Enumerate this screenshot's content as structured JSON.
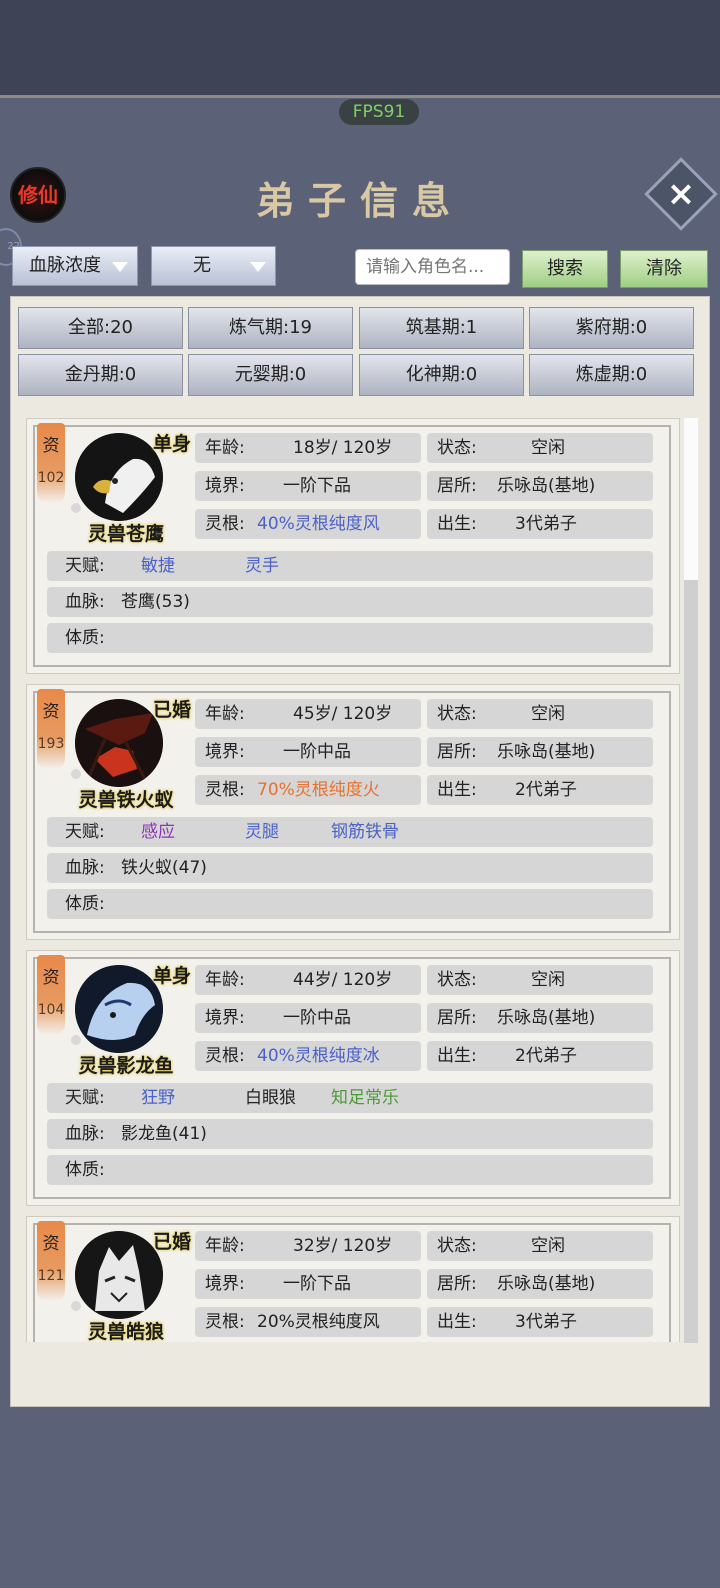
{
  "fps": "FPS91",
  "logo_text": "修仙",
  "side_badge": "22",
  "title": "弟子信息",
  "filters": {
    "sort_dropdown": "血脉浓度",
    "type_dropdown": "无",
    "search_placeholder": "请输入角色名...",
    "search_button": "搜索",
    "clear_button": "清除"
  },
  "realms": [
    "全部:20",
    "炼气期:19",
    "筑基期:1",
    "紫府期:0",
    "金丹期:0",
    "元婴期:0",
    "化神期:0",
    "炼虚期:0"
  ],
  "labels": {
    "zi": "资",
    "age": "年龄:",
    "state": "状态:",
    "realm": "境界:",
    "residence": "居所:",
    "root": "灵根:",
    "birth": "出生:",
    "talent": "天赋:",
    "blood": "血脉:",
    "body": "体质:"
  },
  "disciples": [
    {
      "rank": "102",
      "tag": "单身",
      "name": "灵兽苍鹰",
      "portrait": "eagle-portrait",
      "age": "18岁/ 120岁",
      "state": "空闲",
      "realm": "一阶下品",
      "residence": "乐咏岛(基地)",
      "root": "40%灵根纯度风",
      "root_color": "#4b61c8",
      "birth": "3代弟子",
      "talents": [
        {
          "text": "敏捷",
          "color": "#4b61c8"
        },
        {
          "text": "灵手",
          "color": "#4b61c8"
        }
      ],
      "blood": "苍鹰(53)",
      "body": ""
    },
    {
      "rank": "193",
      "tag": "已婚",
      "name": "灵兽铁火蚁",
      "portrait": "ant-portrait",
      "age": "45岁/ 120岁",
      "state": "空闲",
      "realm": "一阶中品",
      "residence": "乐咏岛(基地)",
      "root": "70%灵根纯度火",
      "root_color": "#e8712f",
      "birth": "2代弟子",
      "talents": [
        {
          "text": "感应",
          "color": "#8a36b0"
        },
        {
          "text": "灵腿",
          "color": "#4b61c8"
        },
        {
          "text": "钢筋铁骨",
          "color": "#4b61c8"
        }
      ],
      "blood": "铁火蚁(47)",
      "body": ""
    },
    {
      "rank": "104",
      "tag": "单身",
      "name": "灵兽影龙鱼",
      "portrait": "dragon-portrait",
      "age": "44岁/ 120岁",
      "state": "空闲",
      "realm": "一阶中品",
      "residence": "乐咏岛(基地)",
      "root": "40%灵根纯度冰",
      "root_color": "#4b61c8",
      "birth": "2代弟子",
      "talents": [
        {
          "text": "狂野",
          "color": "#4b61c8"
        },
        {
          "text": "白眼狼",
          "color": "#222222"
        },
        {
          "text": "知足常乐",
          "color": "#4f9a38"
        }
      ],
      "blood": "影龙鱼(41)",
      "body": ""
    },
    {
      "rank": "121",
      "tag": "已婚",
      "name": "灵兽皓狼",
      "portrait": "wolf-portrait",
      "age": "32岁/ 120岁",
      "state": "空闲",
      "realm": "一阶下品",
      "residence": "乐咏岛(基地)",
      "root": "20%灵根纯度风",
      "root_color": "#222222",
      "birth": "3代弟子",
      "talents": [],
      "blood": "",
      "body": ""
    }
  ]
}
